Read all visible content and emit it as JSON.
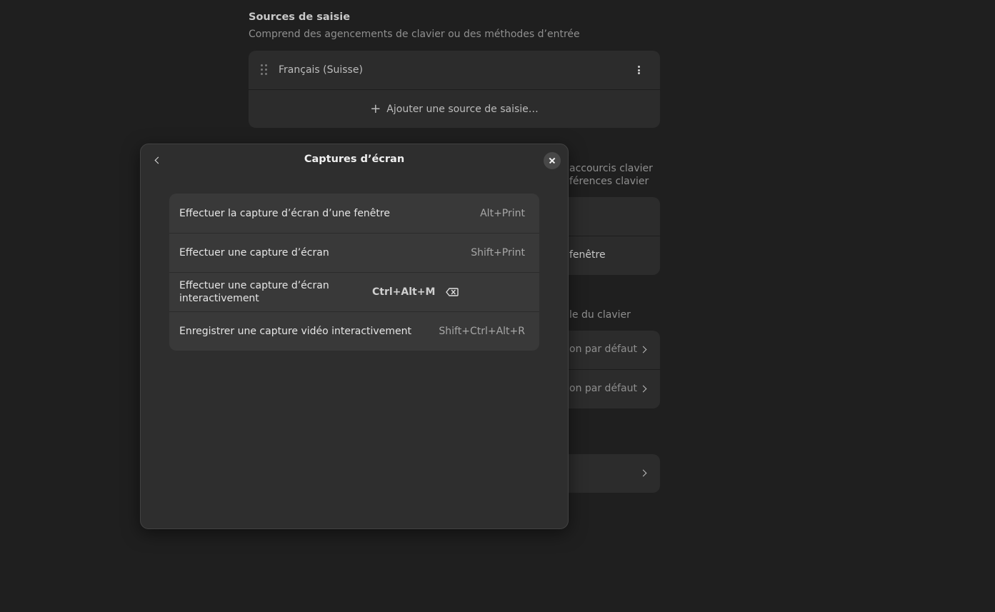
{
  "background": {
    "input_sources": {
      "title": "Sources de saisie",
      "subtitle": "Comprend des agencements de clavier ou des méthodes d’entrée",
      "source_item": "Français (Suisse)",
      "add_label": "Ajouter une source de saisie…"
    },
    "partial_texts": {
      "shortcuts_1": "accourcis clavier",
      "shortcuts_2": "férences clavier",
      "window_row": "fenêtre",
      "keyboard_section": "le du clavier",
      "default_1": "on par défaut",
      "default_2": "on par défaut"
    }
  },
  "dialog": {
    "title": "Captures d’écran",
    "shortcuts": [
      {
        "label": "Effectuer la capture d’écran d’une fenêtre",
        "accel": "Alt+Print"
      },
      {
        "label": "Effectuer une capture d’écran",
        "accel": "Shift+Print"
      },
      {
        "label": "Effectuer une capture d’écran interactivement",
        "accel": "Ctrl+Alt+M"
      },
      {
        "label": "Enregistrer une capture vidéo interactivement",
        "accel": "Shift+Ctrl+Alt+R"
      }
    ]
  },
  "icons": {
    "back": "go-previous-icon",
    "close": "window-close-icon",
    "clear": "edit-clear-icon",
    "drag": "drag-handle-icon",
    "menu": "view-more-icon",
    "add": "list-add-icon"
  }
}
